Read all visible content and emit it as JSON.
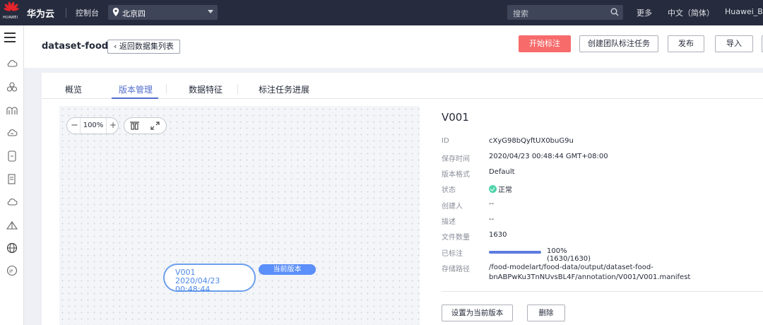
{
  "topbar": {
    "logo_text": "HUAWEI",
    "brand": "华为云",
    "console": "控制台",
    "region": "北京四",
    "search_placeholder": "搜索",
    "more": "更多",
    "language": "中文（简体）",
    "user": "Huawei_Bin"
  },
  "header": {
    "dataset_name": "dataset-food",
    "back_label": "返回数据集列表",
    "buttons": {
      "start_label": "开始标注",
      "team_label": "创建团队标注任务",
      "publish_label": "发布",
      "import_label": "导入"
    }
  },
  "tabs": [
    "概览",
    "版本管理",
    "数据特征",
    "标注任务进展"
  ],
  "active_tab": "版本管理",
  "canvas": {
    "zoom": "100%",
    "node_version": "V001",
    "node_date": "2020/04/23 00:48:44",
    "current_tag": "当前版本"
  },
  "detail": {
    "version": "V001",
    "id_label": "ID",
    "id_value": "cXyG98bQyftUX0buG9u",
    "saved_label": "保存时间",
    "saved_value": "2020/04/23 00:48:44 GMT+08:00",
    "format_label": "版本格式",
    "format_value": "Default",
    "status_label": "状态",
    "status_value": "正常",
    "creator_label": "创建人",
    "creator_value": "--",
    "desc_label": "描述",
    "desc_value": "--",
    "count_label": "文件数量",
    "count_value": "1630",
    "labeled_label": "已标注",
    "labeled_fraction": 1.0,
    "labeled_value": "100% (1630/1630)",
    "path_label": "存储路径",
    "path_value": "/food-modelart/food-data/output/dataset-food-bnABPwKu3TnNUvsBL4F/annotation/V001/V001.manifest",
    "set_current_label": "设置为当前版本",
    "delete_label": "删除"
  },
  "colors": {
    "topbar": "#262b3d",
    "primary_button": "#f76b6b",
    "accent": "#526ecc",
    "status_ok": "#50d4ab"
  }
}
